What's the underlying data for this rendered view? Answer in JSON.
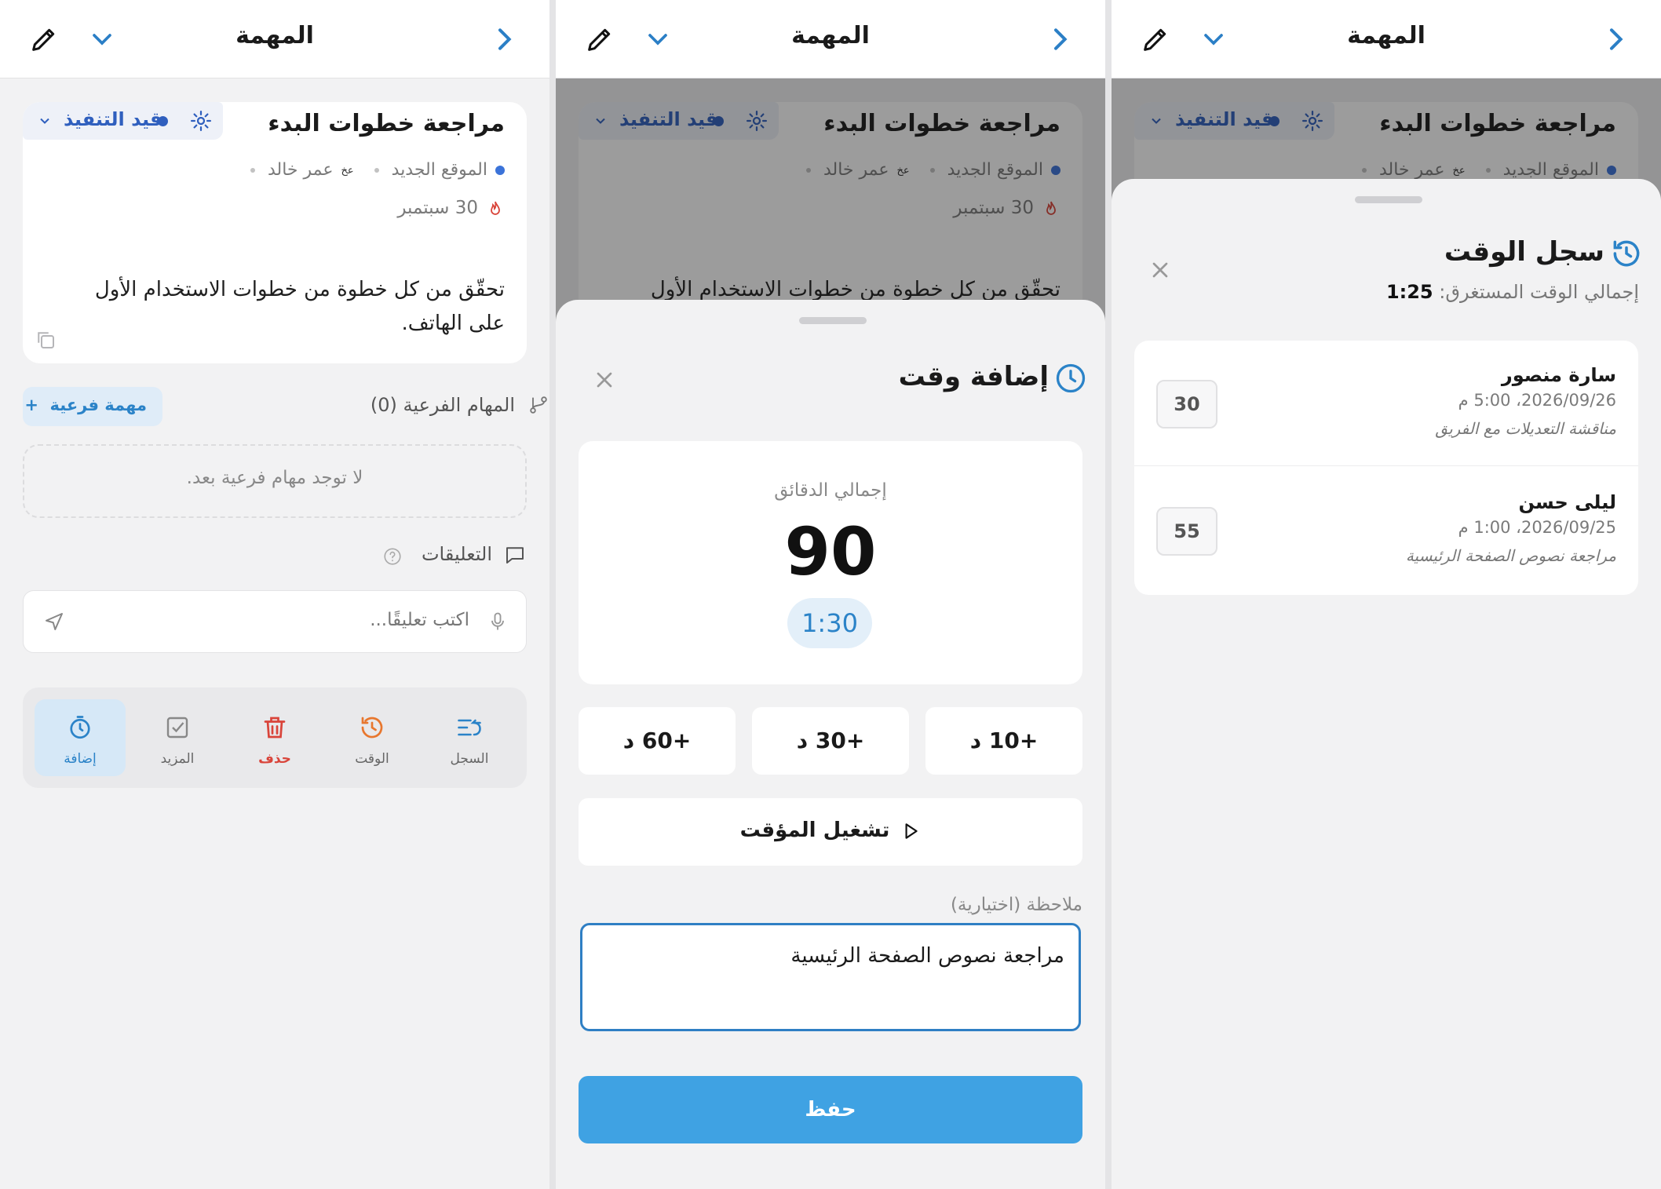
{
  "header": {
    "title": "المهمة"
  },
  "task": {
    "title": "مراجعة خطوات البدء",
    "status": "قيد التنفيذ",
    "project": "الموقع الجديد",
    "assignee_initials": "عخ",
    "assignee": "عمر خالد",
    "due_date": "30 سبتمبر",
    "description": "تحقّق من كل خطوة من خطوات الاستخدام الأول على الهاتف."
  },
  "subtasks": {
    "heading": "المهام الفرعية (0)",
    "add_label": "مهمة فرعية",
    "empty_text": "لا توجد مهام فرعية بعد."
  },
  "comments": {
    "heading": "التعليقات",
    "placeholder": "اكتب تعليقًا..."
  },
  "toolbar": {
    "log": "السجل",
    "time": "الوقت",
    "delete": "حذف",
    "more": "المزيد",
    "add": "إضافة"
  },
  "add_time": {
    "title": "إضافة وقت",
    "total_label": "إجمالي الدقائق",
    "total_minutes": "90",
    "formatted": "1:30",
    "quick": [
      "+10 د",
      "+30 د",
      "+60 د"
    ],
    "timer_label": "تشغيل المؤقت",
    "note_label": "ملاحظة (اختيارية)",
    "note_value": "مراجعة نصوص الصفحة الرئيسية",
    "save_label": "حفظ"
  },
  "time_log": {
    "title": "سجل الوقت",
    "total_label": "إجمالي الوقت المستغرق:",
    "total_value": "1:25",
    "entries": [
      {
        "name": "سارة منصور",
        "when": "2026/09/26، 5:00 م",
        "note": "مناقشة التعديلات مع الفريق",
        "minutes": "30"
      },
      {
        "name": "ليلى حسن",
        "when": "2026/09/25، 1:00 م",
        "note": "مراجعة نصوص الصفحة الرئيسية",
        "minutes": "55"
      }
    ]
  },
  "colors": {
    "accent": "#3fa2e3",
    "status_blue": "#2f5fbe",
    "danger": "#d9443a",
    "orange": "#e8772e"
  }
}
